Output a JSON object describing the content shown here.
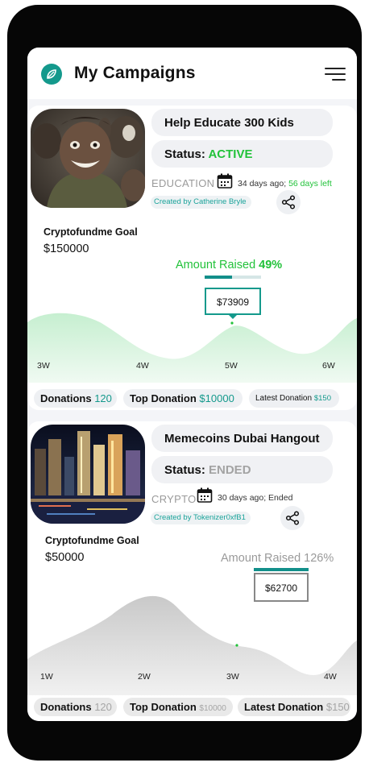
{
  "app": {
    "title": "My Campaigns",
    "logo_icon": "leaf-icon",
    "menu_icon": "hamburger-menu-icon",
    "accent_color": "#14998c",
    "active_color": "#22c23a"
  },
  "campaigns": [
    {
      "name": "Help Educate 300 Kids",
      "status_label": "Status:",
      "status": "ACTIVE",
      "category": "EDUCATION",
      "days_ago": "34 days ago;",
      "days_left": "56 days left",
      "creator": "Created by Catherine Bryle",
      "goal_label": "Cryptofundme Goal",
      "goal": "$150000",
      "raised_label": "Amount Raised",
      "raised_percent_label": "49%",
      "raised_fraction": 0.49,
      "raised_amount": "$73909",
      "weeks": [
        "3W",
        "4W",
        "5W",
        "6W"
      ],
      "donations_label": "Donations",
      "donations": "120",
      "top_donation_label": "Top Donation",
      "top_donation": "$10000",
      "latest_donation_label": "Latest Donation",
      "latest_donation": "$150"
    },
    {
      "name": "Memecoins Dubai Hangout",
      "status_label": "Status:",
      "status": "ENDED",
      "category": "CRYPTO",
      "days_ago": "30 days ago; Ended",
      "creator": "Created by Tokenizer0xfB1",
      "goal_label": "Cryptofundme Goal",
      "goal": "$50000",
      "raised_label": "Amount Raised",
      "raised_percent_label": "126%",
      "raised_fraction": 1.0,
      "raised_amount": "$62700",
      "weeks": [
        "1W",
        "2W",
        "3W",
        "4W"
      ],
      "donations_label": "Donations",
      "donations": "120",
      "top_donation_label": "Top Donation",
      "top_donation": "$10000",
      "latest_donation_label": "Latest Donation",
      "latest_donation": "$150"
    }
  ]
}
